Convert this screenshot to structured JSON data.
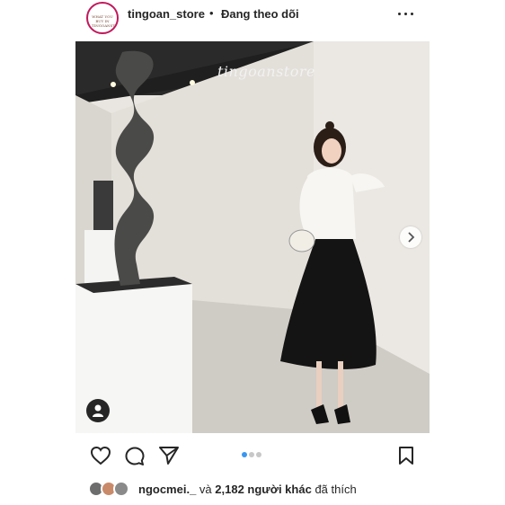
{
  "header": {
    "avatar_text": "WHAT YOU BUY IN TINGOANSTORE",
    "username": "tingoan_store",
    "separator": "•",
    "follow_label": "Đang theo dõi"
  },
  "post": {
    "watermark": "tingoanstore",
    "carousel": {
      "slides": 3,
      "active": 1
    }
  },
  "likes": {
    "first_liker": "ngocmei._",
    "conjunction": "và",
    "count_text": "2,182 người khác",
    "suffix": "đã thích"
  },
  "colors": {
    "accent": "#3897f0",
    "text": "#262626",
    "avatar_ring": "#c2185b"
  },
  "icons": [
    "more-options-icon",
    "next-arrow-icon",
    "tagged-user-icon",
    "heart-icon",
    "comment-icon",
    "share-icon",
    "bookmark-icon"
  ]
}
